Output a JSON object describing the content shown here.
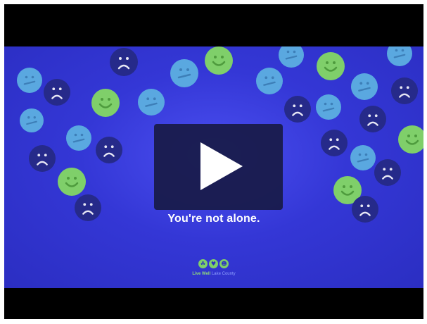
{
  "video": {
    "tagline": "You're not alone.",
    "brand_part1": "Live Well",
    "brand_part2": "Lake County",
    "logo_icons": [
      "leaf-icon",
      "heart-icon",
      "person-icon"
    ]
  },
  "colors": {
    "background": "#3437d6",
    "happy_face": "#7fcf6a",
    "neutral_face": "#5aa8e0",
    "sad_face": "#262a8a",
    "play_overlay": "#181a46"
  }
}
